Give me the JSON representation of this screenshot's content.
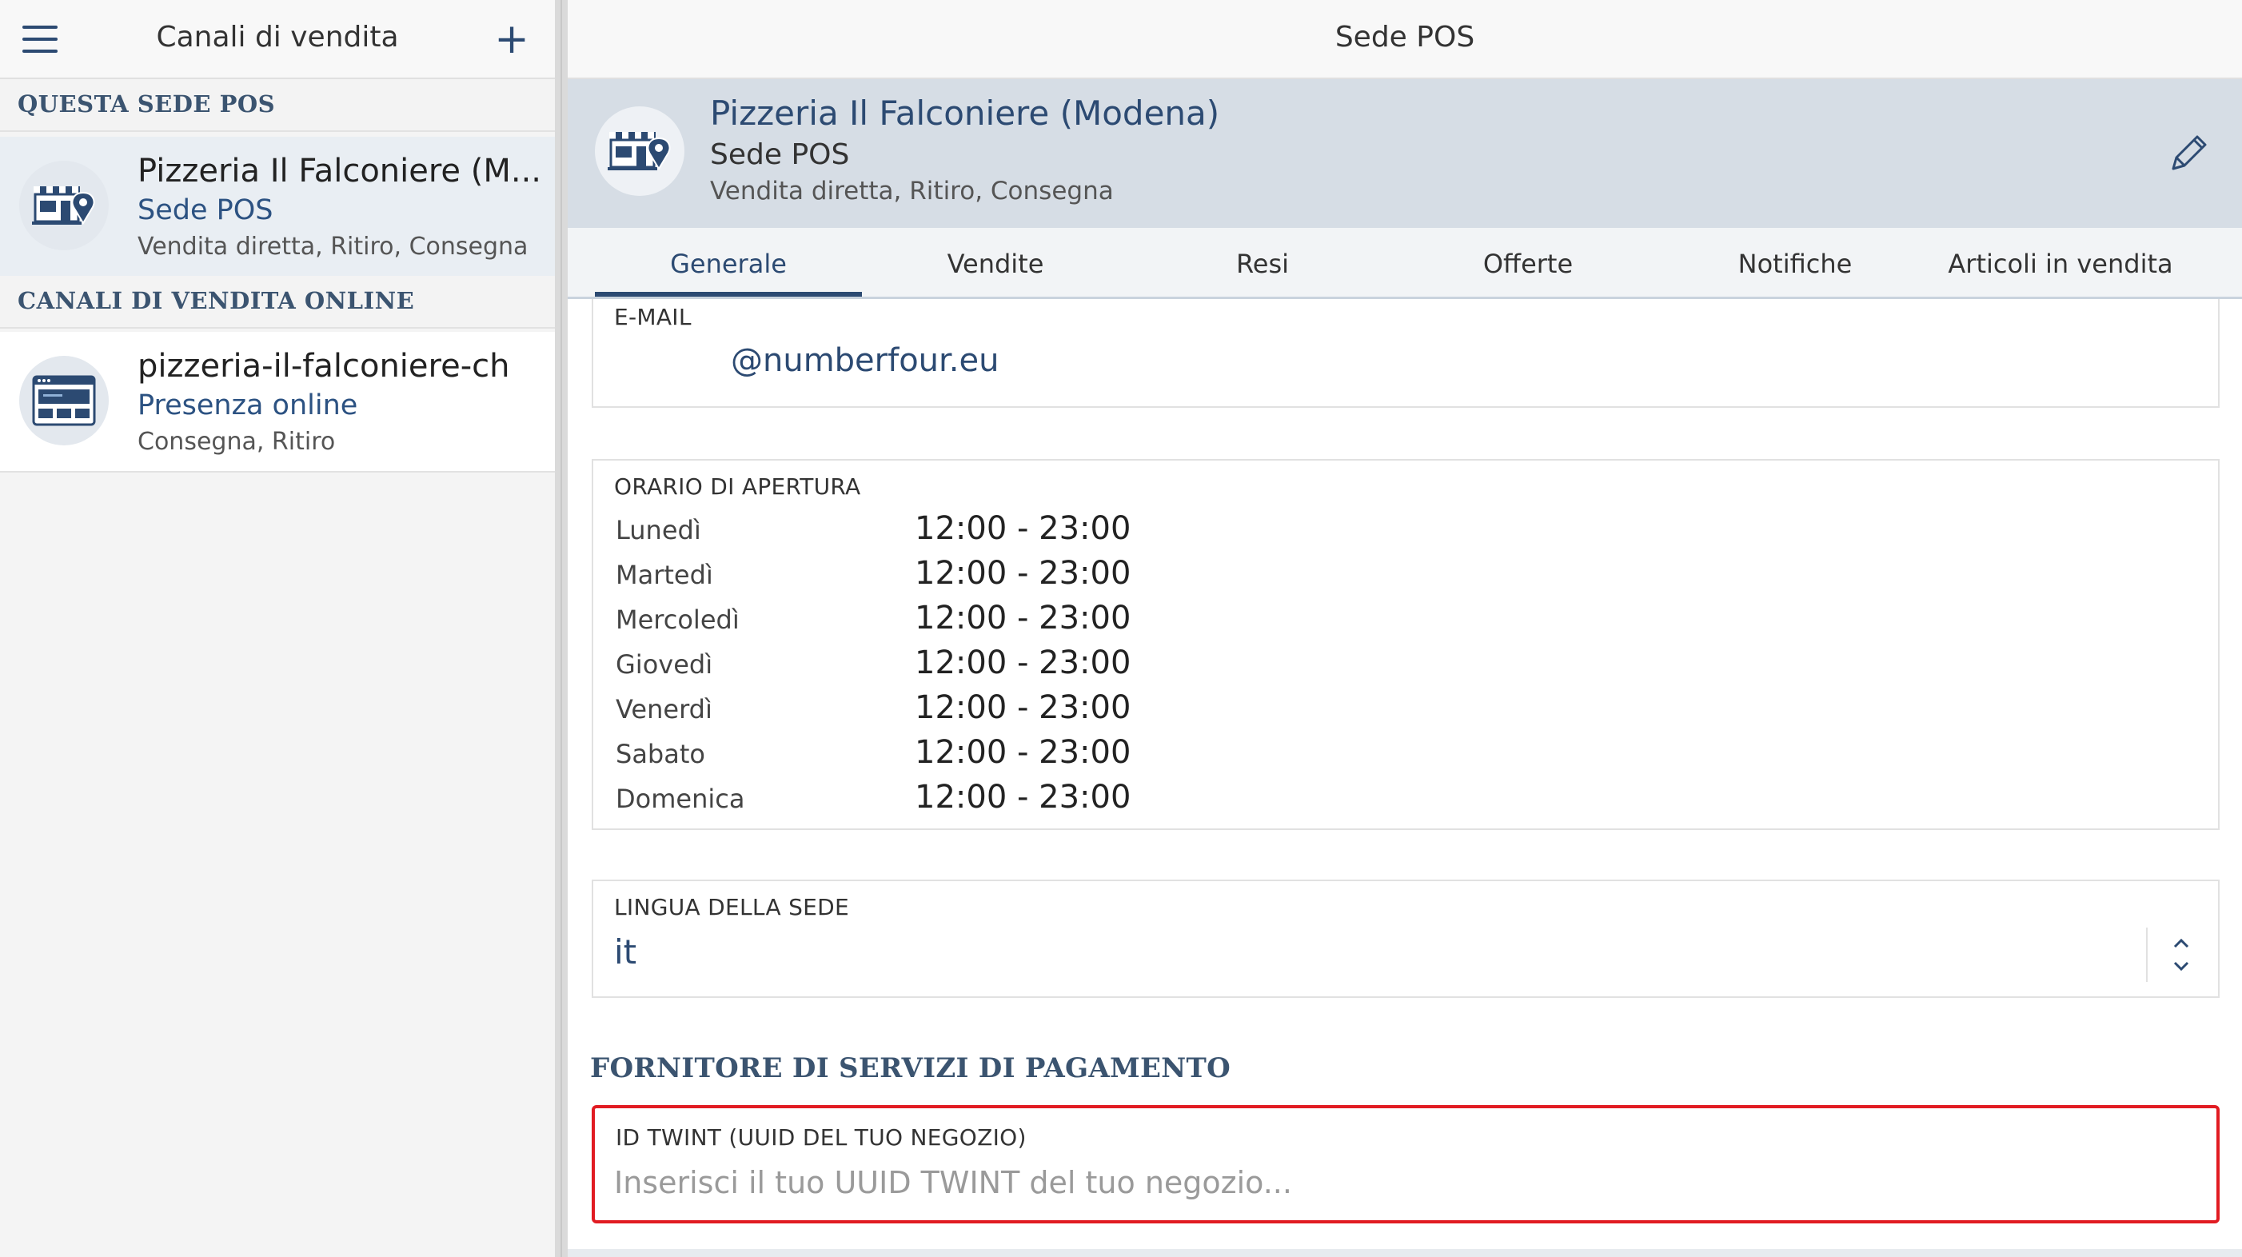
{
  "left_panel": {
    "title": "Canali di vendita",
    "add_symbol": "+",
    "section_this": "QUESTA SEDE POS",
    "section_online": "CANALI DI VENDITA ONLINE",
    "channels": [
      {
        "title": "Pizzeria Il Falconiere (M...",
        "subtitle": "Sede POS",
        "meta": "Vendita diretta, Ritiro, Consegna",
        "icon": "store-location-icon",
        "selected": true
      },
      {
        "title": "pizzeria-il-falconiere-ch",
        "subtitle": "Presenza online",
        "meta": "Consegna, Ritiro",
        "icon": "browser-window-icon",
        "selected": false
      }
    ]
  },
  "right_panel": {
    "title": "Sede POS",
    "location": {
      "name": "Pizzeria Il Falconiere (Modena)",
      "type": "Sede POS",
      "services": "Vendita diretta, Ritiro, Consegna"
    },
    "tabs": [
      "Generale",
      "Vendite",
      "Resi",
      "Offerte",
      "Notifiche",
      "Articoli in vendita"
    ],
    "active_tab": "Generale",
    "email": {
      "label": "E-MAIL",
      "value": "@numberfour.eu"
    },
    "hours": {
      "label": "ORARIO DI APERTURA",
      "rows": [
        {
          "day": "Lunedì",
          "time": "12:00 - 23:00"
        },
        {
          "day": "Martedì",
          "time": "12:00 - 23:00"
        },
        {
          "day": "Mercoledì",
          "time": "12:00 - 23:00"
        },
        {
          "day": "Giovedì",
          "time": "12:00 - 23:00"
        },
        {
          "day": "Venerdì",
          "time": "12:00 - 23:00"
        },
        {
          "day": "Sabato",
          "time": "12:00 - 23:00"
        },
        {
          "day": "Domenica",
          "time": "12:00 - 23:00"
        }
      ]
    },
    "language": {
      "label": "LINGUA DELLA SEDE",
      "value": "it"
    },
    "payment": {
      "heading": "FORNITORE DI SERVIZI DI PAGAMENTO",
      "twint_label": "ID TWINT (UUID DEL TUO NEGOZIO)",
      "twint_placeholder": "Inserisci il tuo UUID TWINT del tuo negozio...",
      "twint_value": ""
    }
  },
  "colors": {
    "accent": "#2c4a72",
    "highlight_border": "#e11b22",
    "header_band": "#d6dde5"
  }
}
